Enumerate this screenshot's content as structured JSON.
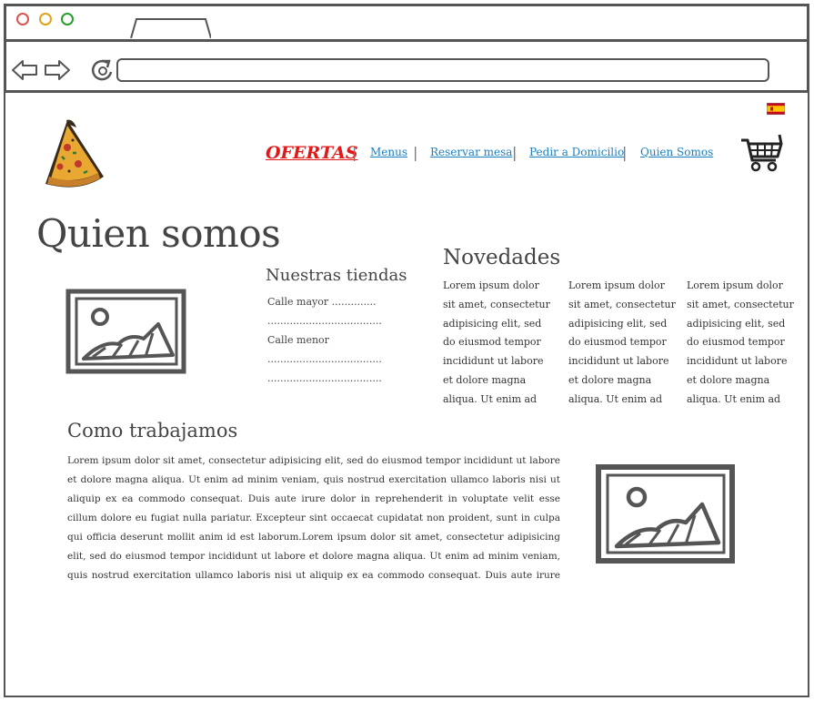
{
  "nav": {
    "ofertas": "OFERTAS",
    "links": [
      "Menus",
      "Reservar mesa",
      "Pedir a Domicilio",
      "Quien Somos"
    ],
    "separator": "|"
  },
  "page": {
    "title": "Quien somos",
    "stores": {
      "heading": "Nuestras tiendas",
      "lines": [
        "Calle mayor ..............",
        "....................................",
        "Calle menor",
        "....................................",
        "...................................."
      ]
    },
    "news": {
      "heading": "Novedades",
      "columns": [
        "Lorem ipsum dolor sit amet, consectetur adipisicing elit, sed do eiusmod tempor incididunt ut labore et dolore magna aliqua. Ut enim ad minim veniam, quis",
        "Lorem ipsum dolor sit amet, consectetur adipisicing elit, sed do eiusmod tempor incididunt ut labore et dolore magna aliqua. Ut enim ad minim veniam, quis",
        "Lorem ipsum dolor sit amet, consectetur adipisicing elit, sed do eiusmod tempor incididunt ut labore et dolore magna aliqua. Ut enim ad minim veniam, quis"
      ]
    },
    "how": {
      "heading": "Como trabajamos",
      "text": "Lorem ipsum dolor sit amet, consectetur adipisicing elit, sed do eiusmod tempor incididunt ut labore et dolore magna aliqua. Ut enim ad minim veniam, quis nostrud exercitation ullamco laboris nisi ut aliquip ex ea commodo consequat. Duis aute irure dolor in reprehenderit in voluptate velit esse cillum dolore eu fugiat nulla pariatur. Excepteur sint occaecat cupidatat non proident, sunt in culpa qui officia deserunt mollit anim id est laborum.Lorem ipsum dolor sit amet, consectetur adipisicing elit, sed do eiusmod tempor incididunt ut labore et dolore magna aliqua. Ut enim ad minim veniam, quis nostrud exercitation ullamco laboris nisi ut aliquip ex ea commodo consequat. Duis aute irure dolor in reprehenderit in voluptate velit esse cillum dolore eu fugiat nulla pariatur. Excepteur sint"
    }
  },
  "colors": {
    "accent": "#e01818",
    "link": "#1a7fc0",
    "stroke": "#555555"
  },
  "icons": [
    "back-icon",
    "forward-icon",
    "reload-icon",
    "pizza-logo-icon",
    "cart-icon",
    "spain-flag-icon",
    "image-placeholder-icon"
  ]
}
